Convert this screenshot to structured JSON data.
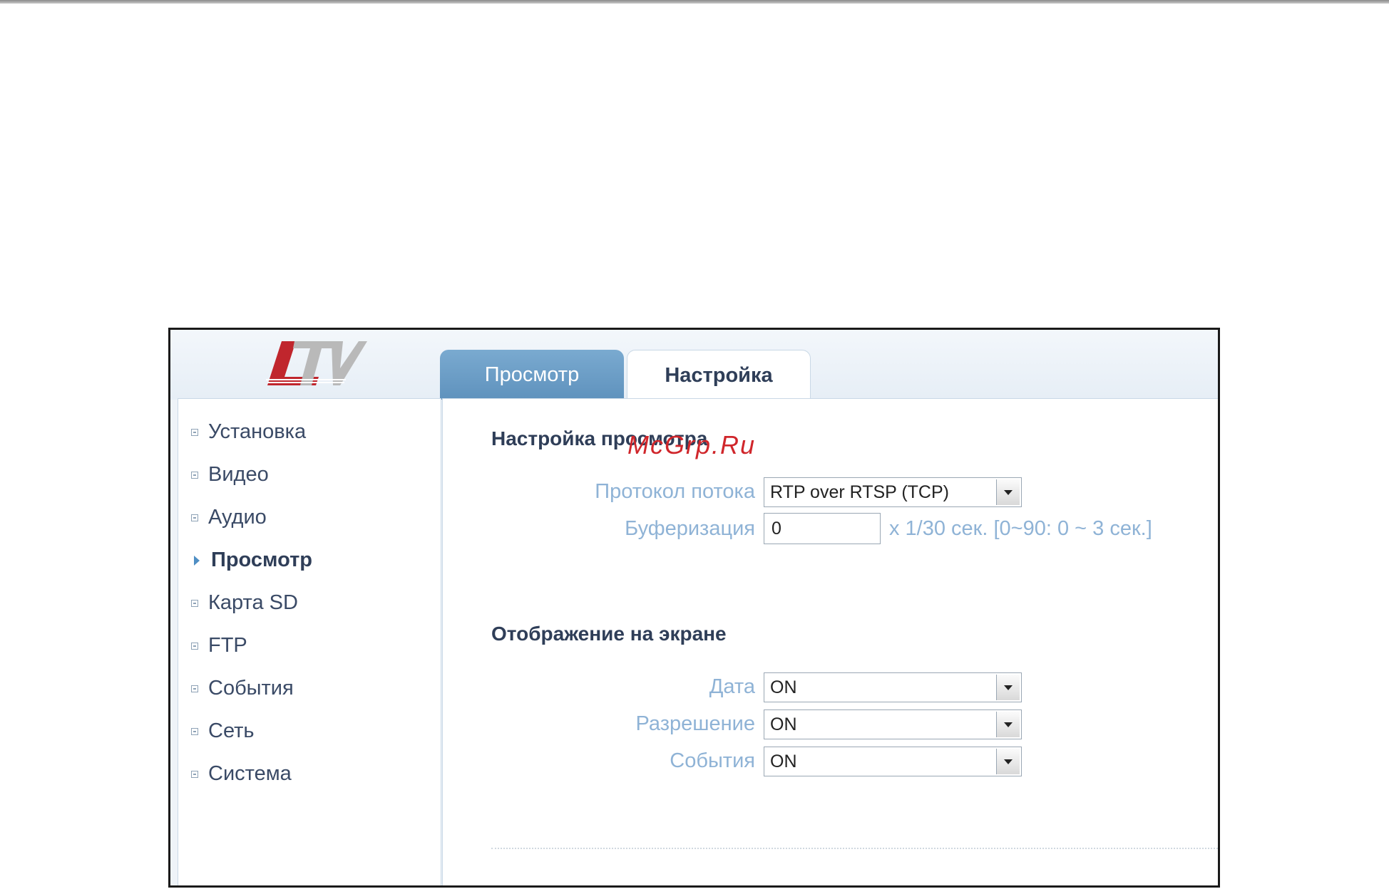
{
  "brand": {
    "logo_text": "LTV",
    "logo_color": "#c0262d"
  },
  "tabs": [
    {
      "label": "Просмотр",
      "active": false
    },
    {
      "label": "Настройка",
      "active": true
    }
  ],
  "sidebar": {
    "items": [
      {
        "label": "Установка",
        "active": false
      },
      {
        "label": "Видео",
        "active": false
      },
      {
        "label": "Аудио",
        "active": false
      },
      {
        "label": "Просмотр",
        "active": true
      },
      {
        "label": "Карта SD",
        "active": false
      },
      {
        "label": "FTP",
        "active": false
      },
      {
        "label": "События",
        "active": false
      },
      {
        "label": "Сеть",
        "active": false
      },
      {
        "label": "Система",
        "active": false
      }
    ]
  },
  "view_settings": {
    "title": "Настройка просмотра",
    "protocol": {
      "label": "Протокол потока",
      "value": "RTP over RTSP (TCP)"
    },
    "buffering": {
      "label": "Буферизация",
      "value": "0",
      "hint": "x 1/30 сек. [0~90: 0 ~ 3 сек.]"
    }
  },
  "osd": {
    "title": "Отображение на экране",
    "fields": [
      {
        "label": "Дата",
        "value": "ON"
      },
      {
        "label": "Разрешение",
        "value": "ON"
      },
      {
        "label": "События",
        "value": "ON"
      }
    ]
  },
  "watermark": "McGrp.Ru",
  "colors": {
    "accent": "#5f92bd",
    "label": "#8fb3d6",
    "heading": "#2f3e58"
  }
}
